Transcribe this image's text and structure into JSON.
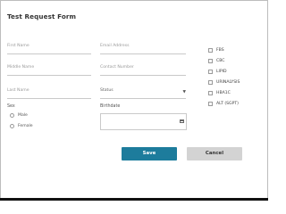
{
  "form": {
    "title": "Test Request Form",
    "first_name_placeholder": "First Name",
    "middle_name_placeholder": "Middle Name",
    "last_name_placeholder": "Last Name",
    "email_placeholder": "Email Address",
    "contact_placeholder": "Contact Number",
    "status_placeholder": "Status",
    "sex_label": "Sex",
    "sex_options": [
      "Male",
      "Female"
    ],
    "birthdate_label": "Birthdate",
    "tests": [
      "FBS",
      "CBC",
      "LIPID",
      "URINALYSIS",
      "HBA1C",
      "ALT (SGPT)"
    ],
    "save_label": "Save",
    "cancel_label": "Cancel",
    "caret_icon": "chevron-down-icon",
    "calendar_icon": "calendar-icon"
  },
  "colors": {
    "save_bg": "#1d7c9c",
    "cancel_bg": "#d3d3d3",
    "border": "#c9c9c9"
  }
}
